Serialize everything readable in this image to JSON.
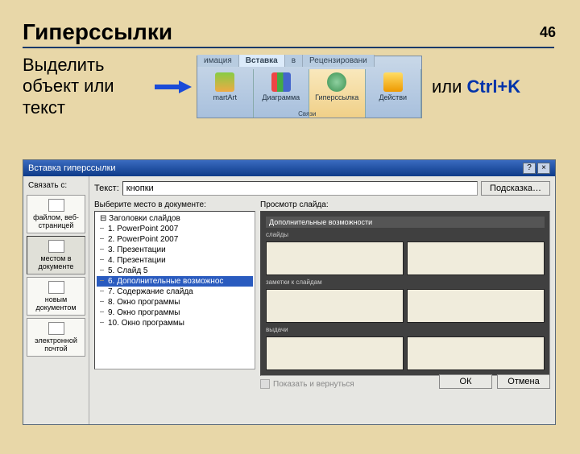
{
  "page_number": "46",
  "title": "Гиперссылки",
  "instruction": "Выделить объект или текст",
  "or_text": "или",
  "shortcut": "Ctrl+K",
  "ribbon": {
    "tabs": [
      "имация",
      "Вставка",
      "в",
      "Рецензировани"
    ],
    "active_tab": "Вставка",
    "items": [
      "martArt",
      "Диаграмма",
      "Гиперссылка",
      "Действи"
    ],
    "group": "Связи"
  },
  "dialog": {
    "title": "Вставка гиперссылки",
    "help": "?",
    "close": "×",
    "side_label": "Связать с:",
    "side_items": [
      "файлом, веб-страницей",
      "местом в документе",
      "новым документом",
      "электронной почтой"
    ],
    "text_label": "Текст:",
    "text_value": "кнопки",
    "hint_btn": "Подсказка…",
    "outline_label": "Выберите место в документе:",
    "outline": [
      "Заголовки слайдов",
      "1. PowerPoint 2007",
      "2. PowerPoint 2007",
      "3. Презентации",
      "4. Презентации",
      "5. Слайд 5",
      "6. Дополнительные возможнос",
      "7. Содержание слайда",
      "8. Окно программы",
      "9. Окно программы",
      "10. Окно программы"
    ],
    "outline_selected": 6,
    "preview_label": "Просмотр слайда:",
    "preview_title": "Дополнительные возможности",
    "pv_labels": [
      "слайды",
      "заметки к слайдам",
      "выдачи"
    ],
    "checkbox": "Показать и вернуться",
    "ok": "ОК",
    "cancel": "Отмена"
  }
}
